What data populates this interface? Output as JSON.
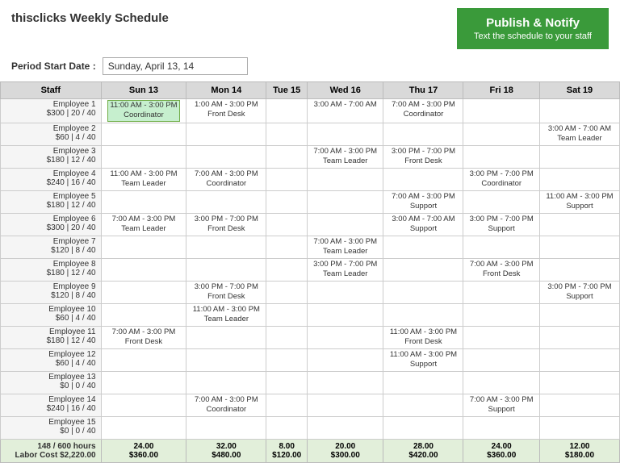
{
  "app": {
    "title": "thisclicks Weekly Schedule"
  },
  "publish_button": {
    "title": "Publish & Notify",
    "subtitle": "Text the schedule to your staff"
  },
  "period": {
    "label": "Period Start Date :",
    "value": "Sunday, April 13, 14"
  },
  "table": {
    "headers": [
      "Staff",
      "Sun 13",
      "Mon 14",
      "Tue 15",
      "Wed 16",
      "Thu 17",
      "Fri 18",
      "Sat 19"
    ],
    "rows": [
      {
        "staff": [
          "Employee 1",
          "$300 | 20 / 40"
        ],
        "sun": {
          "time": "11:00 AM - 3:00 PM",
          "role": "Coordinator",
          "highlight": true
        },
        "mon": {
          "time": "1:00 AM - 3:00 PM",
          "role": "Front Desk"
        },
        "tue": {},
        "wed": {
          "time": "3:00 AM - 7:00 AM",
          "role": ""
        },
        "thu": {
          "time": "7:00 AM - 3:00 PM",
          "role": "Coordinator"
        },
        "fri": {},
        "sat": {}
      },
      {
        "staff": [
          "Employee 2",
          "$60 | 4 / 40"
        ],
        "sun": {},
        "mon": {},
        "tue": {},
        "wed": {},
        "thu": {},
        "fri": {},
        "sat": {
          "time": "3:00 AM - 7:00 AM",
          "role": "Team Leader"
        }
      },
      {
        "staff": [
          "Employee 3",
          "$180 | 12 / 40"
        ],
        "sun": {},
        "mon": {},
        "tue": {},
        "wed": {
          "time": "7:00 AM - 3:00 PM",
          "role": "Team Leader"
        },
        "thu": {
          "time": "3:00 PM - 7:00 PM",
          "role": "Front Desk"
        },
        "fri": {},
        "sat": {}
      },
      {
        "staff": [
          "Employee 4",
          "$240 | 16 / 40"
        ],
        "sun": {
          "time": "11:00 AM - 3:00 PM",
          "role": "Team Leader"
        },
        "mon": {
          "time": "7:00 AM - 3:00 PM",
          "role": "Coordinator"
        },
        "tue": {},
        "wed": {},
        "thu": {},
        "fri": {
          "time": "3:00 PM - 7:00 PM",
          "role": "Coordinator"
        },
        "sat": {}
      },
      {
        "staff": [
          "Employee 5",
          "$180 | 12 / 40"
        ],
        "sun": {},
        "mon": {},
        "tue": {},
        "wed": {},
        "thu": {
          "time": "7:00 AM - 3:00 PM",
          "role": "Support"
        },
        "fri": {},
        "sat": {
          "time": "11:00 AM - 3:00 PM",
          "role": "Support"
        }
      },
      {
        "staff": [
          "Employee 6",
          "$300 | 20 / 40"
        ],
        "sun": {
          "time": "7:00 AM - 3:00 PM",
          "role": "Team Leader"
        },
        "mon": {
          "time": "3:00 PM - 7:00 PM",
          "role": "Front Desk"
        },
        "tue": {},
        "wed": {},
        "thu": {
          "time": "3:00 AM - 7:00 AM",
          "role": "Support"
        },
        "fri": {
          "time": "3:00 PM - 7:00 PM",
          "role": "Support"
        },
        "sat": {}
      },
      {
        "staff": [
          "Employee 7",
          "$120 | 8 / 40"
        ],
        "sun": {},
        "mon": {},
        "tue": {},
        "wed": {
          "time": "7:00 AM - 3:00 PM",
          "role": "Team Leader"
        },
        "thu": {},
        "fri": {},
        "sat": {}
      },
      {
        "staff": [
          "Employee 8",
          "$180 | 12 / 40"
        ],
        "sun": {},
        "mon": {},
        "tue": {},
        "wed": {
          "time": "3:00 PM - 7:00 PM",
          "role": "Team Leader"
        },
        "thu": {},
        "fri": {
          "time": "7:00 AM - 3:00 PM",
          "role": "Front Desk"
        },
        "sat": {}
      },
      {
        "staff": [
          "Employee 9",
          "$120 | 8 / 40"
        ],
        "sun": {},
        "mon": {
          "time": "3:00 PM - 7:00 PM",
          "role": "Front Desk"
        },
        "tue": {},
        "wed": {},
        "thu": {},
        "fri": {},
        "sat": {
          "time": "3:00 PM - 7:00 PM",
          "role": "Support"
        }
      },
      {
        "staff": [
          "Employee 10",
          "$60 | 4 / 40"
        ],
        "sun": {},
        "mon": {
          "time": "11:00 AM - 3:00 PM",
          "role": "Team Leader"
        },
        "tue": {},
        "wed": {},
        "thu": {},
        "fri": {},
        "sat": {}
      },
      {
        "staff": [
          "Employee 11",
          "$180 | 12 / 40"
        ],
        "sun": {
          "time": "7:00 AM - 3:00 PM",
          "role": "Front Desk"
        },
        "mon": {},
        "tue": {},
        "wed": {},
        "thu": {
          "time": "11:00 AM - 3:00 PM",
          "role": "Front Desk"
        },
        "fri": {},
        "sat": {}
      },
      {
        "staff": [
          "Employee 12",
          "$60 | 4 / 40"
        ],
        "sun": {},
        "mon": {},
        "tue": {},
        "wed": {},
        "thu": {
          "time": "11:00 AM - 3:00 PM",
          "role": "Support"
        },
        "fri": {},
        "sat": {}
      },
      {
        "staff": [
          "Employee 13",
          "$0 | 0 / 40"
        ],
        "sun": {},
        "mon": {},
        "tue": {},
        "wed": {},
        "thu": {},
        "fri": {},
        "sat": {}
      },
      {
        "staff": [
          "Employee 14",
          "$240 | 16 / 40"
        ],
        "sun": {},
        "mon": {
          "time": "7:00 AM - 3:00 PM",
          "role": "Coordinator"
        },
        "tue": {},
        "wed": {},
        "thu": {},
        "fri": {
          "time": "7:00 AM - 3:00 PM",
          "role": "Support"
        },
        "sat": {}
      },
      {
        "staff": [
          "Employee 15",
          "$0 | 0 / 40"
        ],
        "sun": {},
        "mon": {},
        "tue": {},
        "wed": {},
        "thu": {},
        "fri": {},
        "sat": {}
      }
    ],
    "footer": {
      "hours_label": "148 / 600 hours",
      "cost_label": "Labor Cost $2,220.00",
      "sun": "24.00",
      "mon": "32.00",
      "tue": "8.00",
      "wed": "20.00",
      "thu": "28.00",
      "fri": "24.00",
      "sat": "12.00",
      "sun_cost": "$360.00",
      "mon_cost": "$480.00",
      "tue_cost": "$120.00",
      "wed_cost": "$300.00",
      "thu_cost": "$420.00",
      "fri_cost": "$360.00",
      "sat_cost": "$180.00"
    }
  }
}
